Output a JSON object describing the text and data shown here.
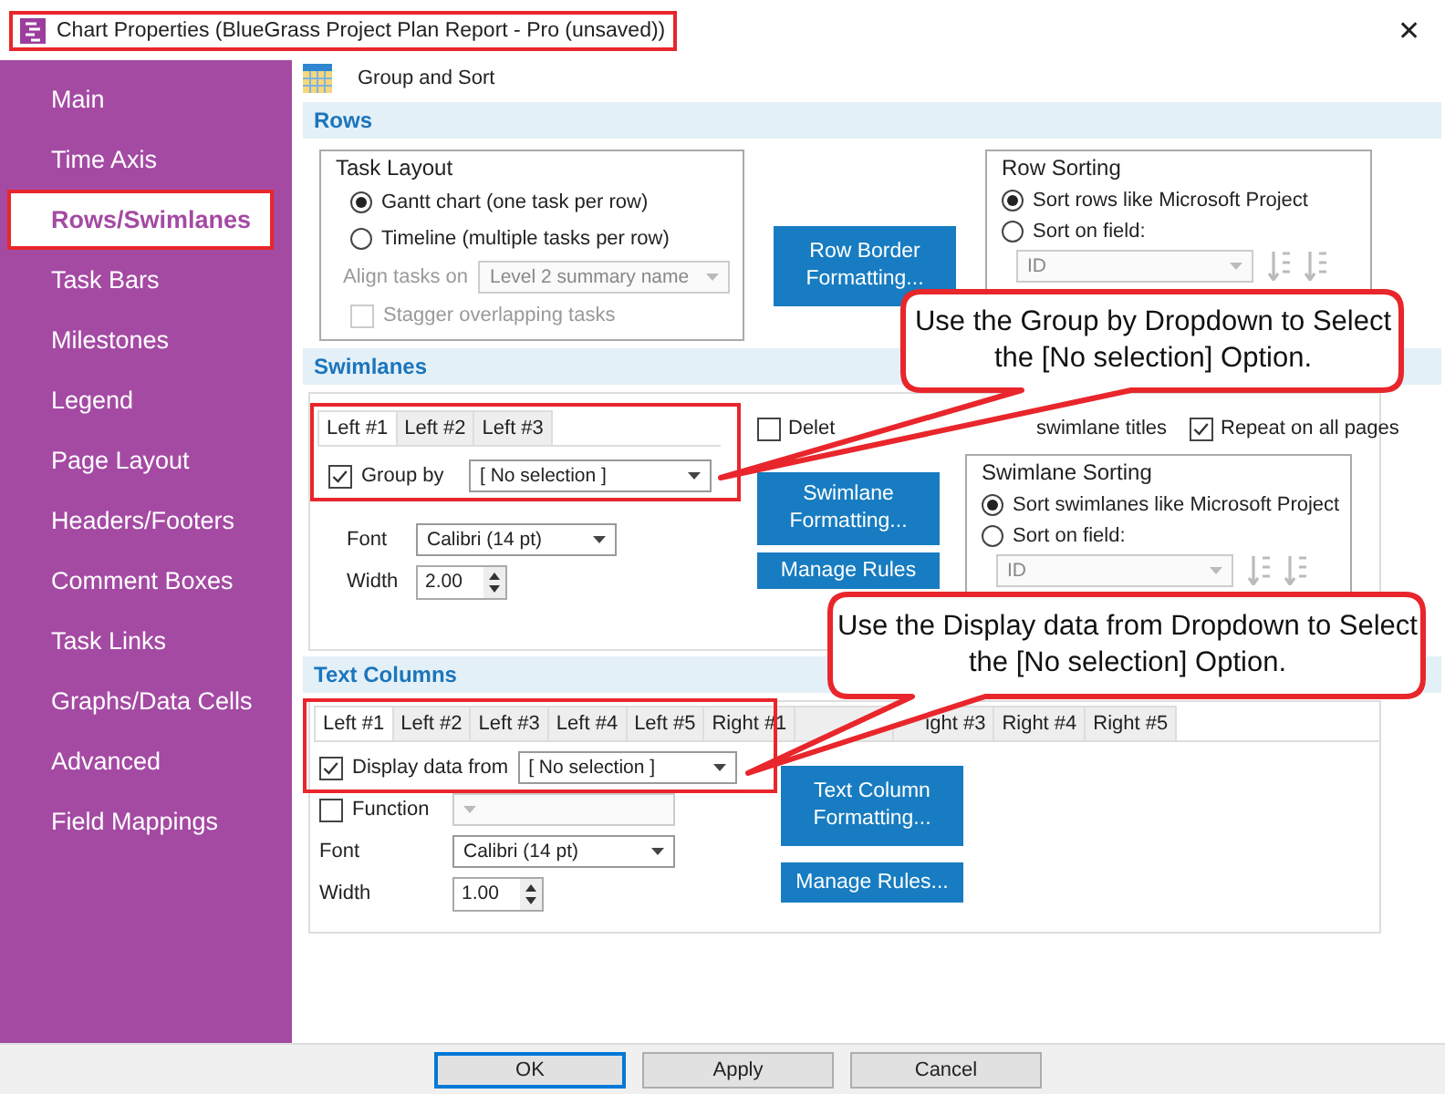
{
  "window": {
    "title": "Chart Properties (BlueGrass Project Plan Report - Pro (unsaved))",
    "highlighted": true,
    "close": "✕"
  },
  "sidebar": {
    "items": [
      {
        "label": "Main",
        "selected": false,
        "highlighted": false
      },
      {
        "label": "Time Axis",
        "selected": false,
        "highlighted": false
      },
      {
        "label": "Rows/Swimlanes",
        "selected": true,
        "highlighted": true
      },
      {
        "label": "Task Bars",
        "selected": false,
        "highlighted": false
      },
      {
        "label": "Milestones",
        "selected": false,
        "highlighted": false
      },
      {
        "label": "Legend",
        "selected": false,
        "highlighted": false
      },
      {
        "label": "Page Layout",
        "selected": false,
        "highlighted": false
      },
      {
        "label": "Headers/Footers",
        "selected": false,
        "highlighted": false
      },
      {
        "label": "Comment Boxes",
        "selected": false,
        "highlighted": false
      },
      {
        "label": "Task Links",
        "selected": false,
        "highlighted": false
      },
      {
        "label": "Graphs/Data Cells",
        "selected": false,
        "highlighted": false
      },
      {
        "label": "Advanced",
        "selected": false,
        "highlighted": false
      },
      {
        "label": "Field Mappings",
        "selected": false,
        "highlighted": false
      }
    ]
  },
  "page": {
    "title": "Group and Sort"
  },
  "rows": {
    "title": "Rows",
    "task_layout": {
      "title": "Task Layout",
      "options": [
        {
          "label": "Gantt chart (one task per row)",
          "selected": true
        },
        {
          "label": "Timeline (multiple tasks per row)",
          "selected": false
        }
      ],
      "align": {
        "label": "Align tasks on",
        "value": "Level 2 summary name",
        "disabled": true
      },
      "stagger": {
        "label": "Stagger overlapping tasks",
        "checked": false,
        "disabled": true
      }
    },
    "button": "Row Border Formatting...",
    "sorting": {
      "title": "Row Sorting",
      "options": [
        {
          "label": "Sort rows like Microsoft Project",
          "selected": true
        },
        {
          "label": "Sort on field:",
          "selected": false
        }
      ],
      "field": {
        "value": "ID",
        "disabled": true
      }
    }
  },
  "swimlanes": {
    "title": "Swimlanes",
    "highlighted": true,
    "tabs": [
      {
        "label": "Left #1",
        "selected": true
      },
      {
        "label": "Left #2",
        "selected": false
      },
      {
        "label": "Left #3",
        "selected": false
      }
    ],
    "group_by": {
      "label": "Group by",
      "checked": true,
      "value": "[ No selection ]"
    },
    "font": {
      "label": "Font",
      "value": "Calibri (14 pt)"
    },
    "width": {
      "label": "Width",
      "value": "2.00"
    },
    "options": [
      {
        "label": "Delet",
        "trailing_text": "swimlane titles",
        "checked": false
      },
      {
        "label": "Repeat on all pages",
        "checked": true
      }
    ],
    "buttons": [
      "Swimlane Formatting...",
      "Manage Rules"
    ],
    "sorting": {
      "title": "Swimlane Sorting",
      "options": [
        {
          "label": "Sort swimlanes like Microsoft Project",
          "selected": true
        },
        {
          "label": "Sort on field:",
          "selected": false
        }
      ],
      "field": {
        "value": "ID",
        "disabled": true
      }
    }
  },
  "text_columns": {
    "title": "Text Columns",
    "highlighted": true,
    "tabs": [
      {
        "label": "Left #1",
        "selected": true
      },
      {
        "label": "Left #2",
        "selected": false
      },
      {
        "label": "Left #3",
        "selected": false
      },
      {
        "label": "Left #4",
        "selected": false
      },
      {
        "label": "Left #5",
        "selected": false
      },
      {
        "label": "Right #1",
        "selected": false
      },
      {
        "selected": false
      },
      {
        "label": "ight #3",
        "selected": false
      },
      {
        "label": "Right #4",
        "selected": false
      },
      {
        "label": "Right #5",
        "selected": false
      }
    ],
    "display": {
      "label": "Display data from",
      "checked": true,
      "value": "[ No selection ]"
    },
    "function": {
      "label": "Function",
      "checked": false
    },
    "font": {
      "label": "Font",
      "value": "Calibri (14 pt)"
    },
    "width": {
      "label": "Width",
      "value": "1.00"
    },
    "buttons": [
      "Text Column Formatting...",
      "Manage Rules..."
    ]
  },
  "callouts": [
    {
      "text": "Use the Group by Dropdown to Select the [No selection] Option."
    },
    {
      "text": "Use the Display data from Dropdown to Select the [No selection] Option."
    }
  ],
  "footer": {
    "buttons": [
      {
        "label": "OK",
        "default": true
      },
      {
        "label": "Apply",
        "default": false
      },
      {
        "label": "Cancel",
        "default": false
      }
    ]
  }
}
